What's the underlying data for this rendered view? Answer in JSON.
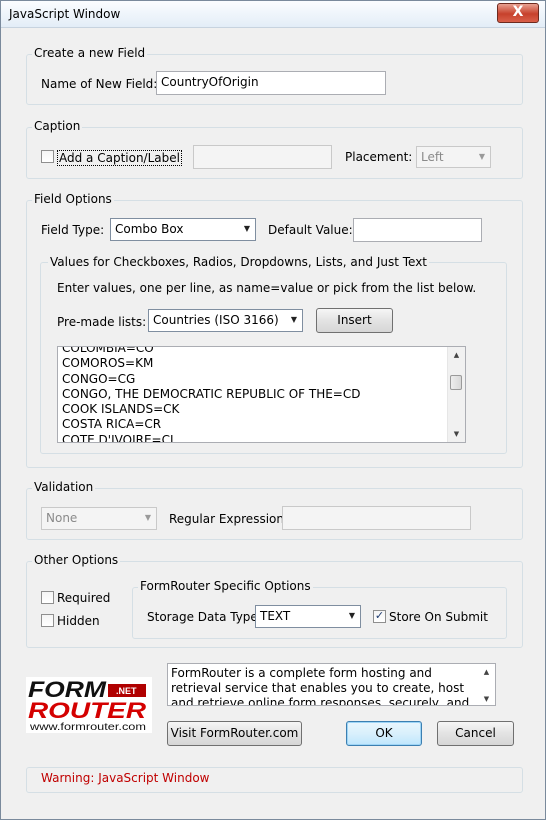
{
  "window": {
    "title": "JavaScript Window",
    "close_glyph": "X"
  },
  "create": {
    "group_title": "Create a new Field",
    "name_label": "Name of New Field:",
    "name_value": "CountryOfOrigin"
  },
  "caption": {
    "group_title": "Caption",
    "add_label": "Add a Caption/Label",
    "add_checked": false,
    "caption_value": "",
    "placement_label": "Placement:",
    "placement_value": "Left"
  },
  "field_options": {
    "group_title": "Field Options",
    "type_label": "Field Type:",
    "type_value": "Combo Box",
    "default_label": "Default Value:",
    "default_value": "",
    "values_group_title": "Values for Checkboxes, Radios, Dropdowns, Lists, and Just Text",
    "instructions": "Enter values, one per line, as name=value or pick from the list below.",
    "premade_label": "Pre-made lists:",
    "premade_value": "Countries (ISO 3166)",
    "insert_label": "Insert",
    "values": [
      "COLOMBIA=CO",
      "COMOROS=KM",
      "CONGO=CG",
      "CONGO, THE DEMOCRATIC REPUBLIC OF THE=CD",
      "COOK ISLANDS=CK",
      "COSTA RICA=CR",
      "COTE D'IVOIRE=CI"
    ]
  },
  "validation": {
    "group_title": "Validation",
    "type_value": "None",
    "regex_label": "Regular Expression:",
    "regex_value": ""
  },
  "other": {
    "group_title": "Other Options",
    "required_label": "Required",
    "required_checked": false,
    "hidden_label": "Hidden",
    "hidden_checked": false,
    "fr_group_title": "FormRouter Specific Options",
    "storage_label": "Storage Data Type",
    "storage_value": "TEXT",
    "store_label": "Store On Submit",
    "store_checked": true
  },
  "footer": {
    "logo_form": "FORM",
    "logo_net": ".NET",
    "logo_router": "ROUTER",
    "logo_url": "www.formrouter.com",
    "info_text": "FormRouter is a complete form hosting and retrieval service that enables you to create, host and retrieve online form responses, securely, and with no programming",
    "visit_label": "Visit FormRouter.com",
    "ok_label": "OK",
    "cancel_label": "Cancel",
    "warning": "Warning: JavaScript Window"
  },
  "colors": {
    "warning": "#c00000",
    "logo_red": "#d40000",
    "accent": "#3c7fb1"
  },
  "icons": {
    "close": "close-icon",
    "dropdown": "chevron-down-icon",
    "check": "checkmark-icon"
  }
}
